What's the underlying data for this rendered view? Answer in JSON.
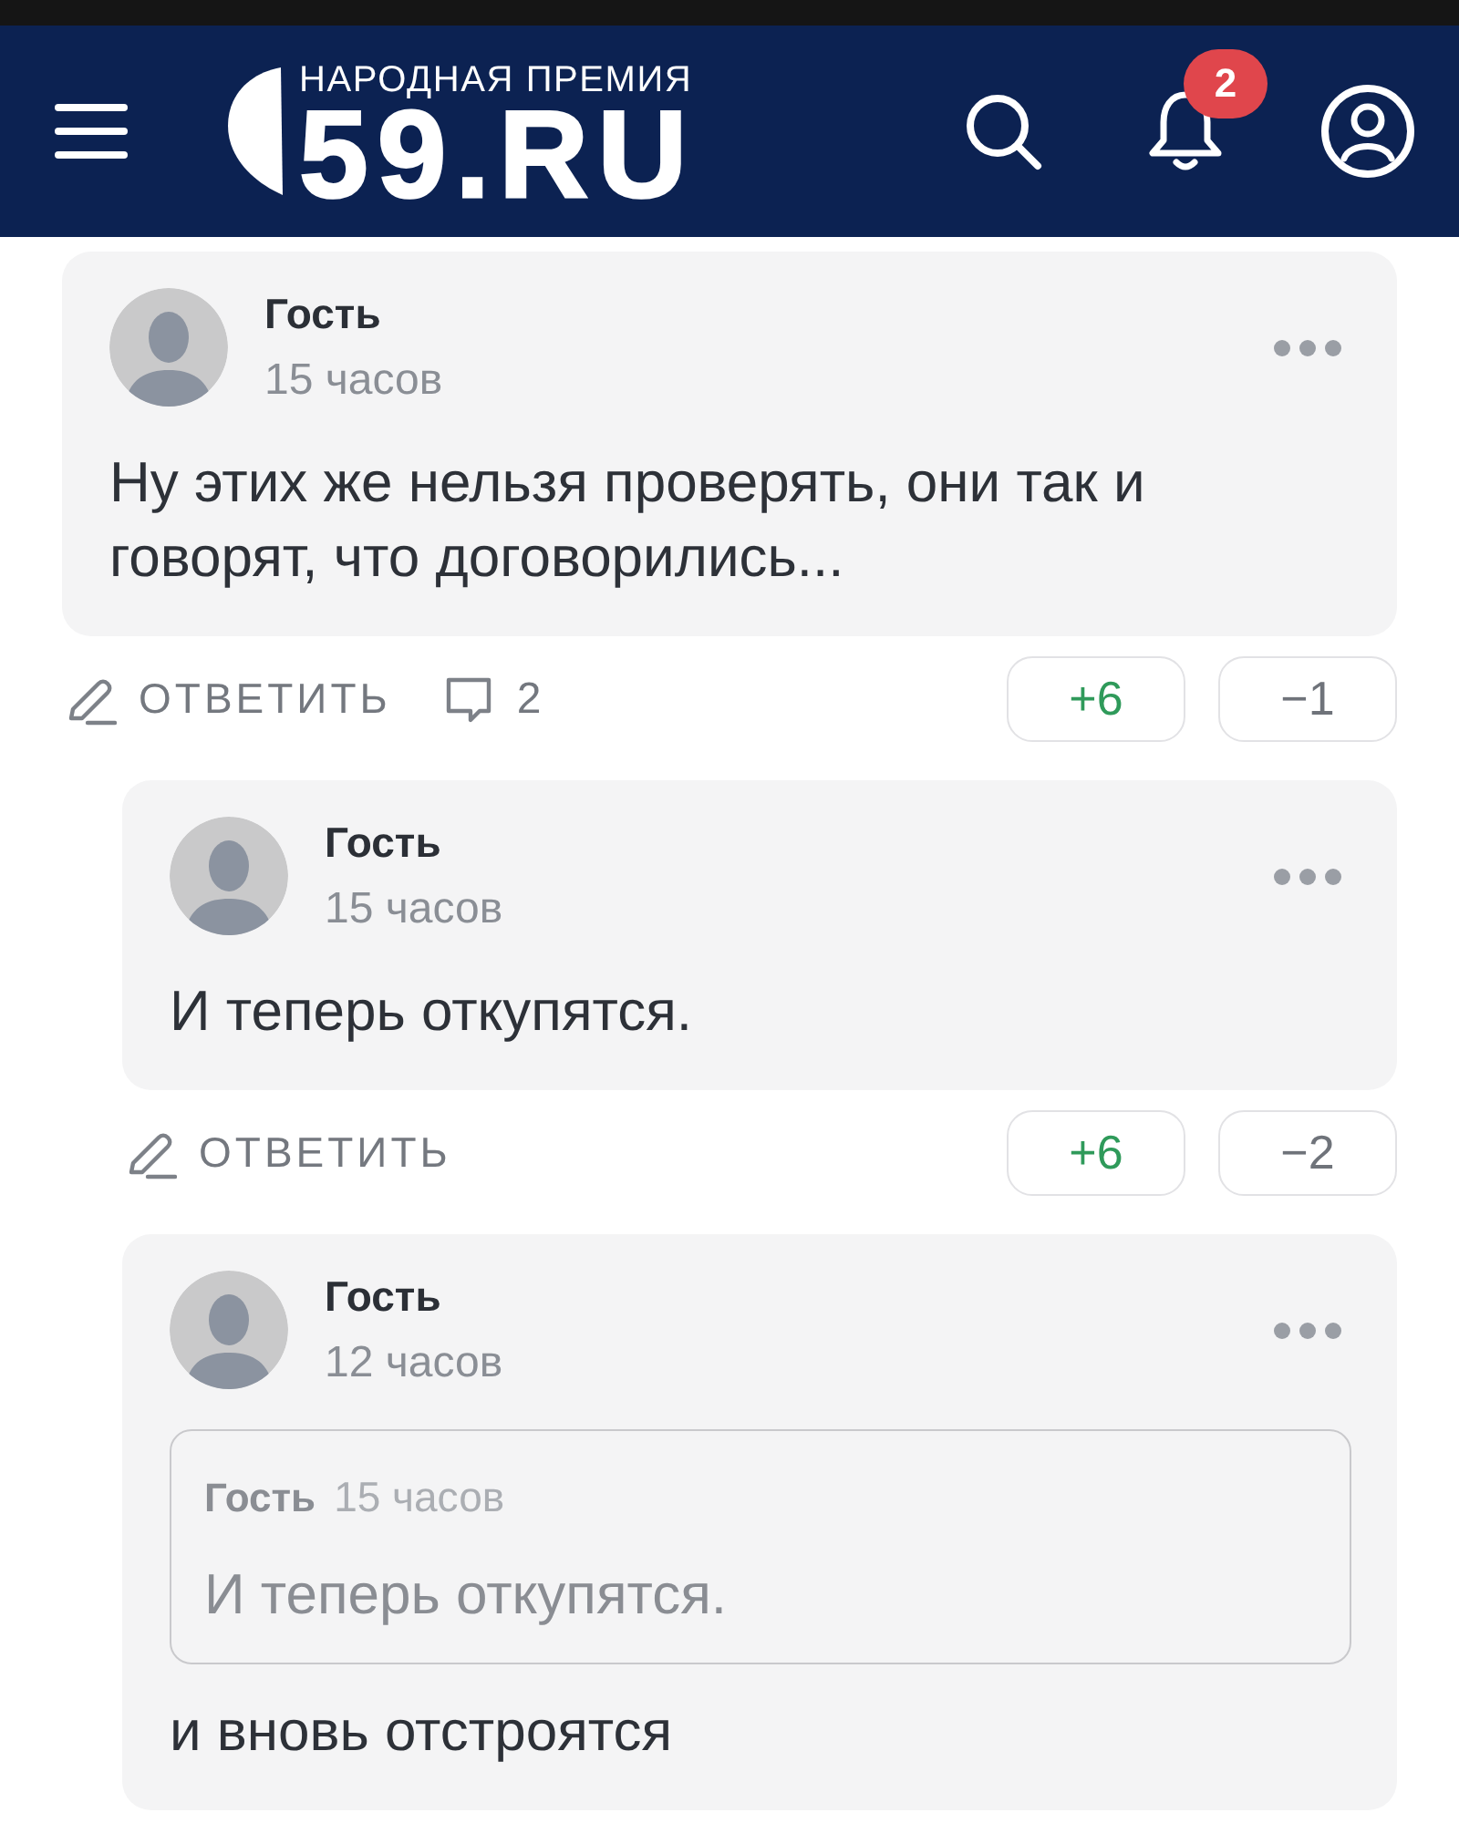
{
  "header": {
    "logo": {
      "caption": "НАРОДНАЯ ПРЕМИЯ",
      "wordmark": "59.RU"
    },
    "notification_badge": "2"
  },
  "comments": [
    {
      "author": "Гость",
      "time": "15 часов",
      "text": "Ну этих же нельзя проверять, они так и говорят, что договорились...",
      "actions": {
        "reply": "ОТВЕТИТЬ",
        "reply_count": "2",
        "votes": [
          {
            "kind": "up",
            "label": "+6"
          },
          {
            "kind": "down",
            "label": "−1"
          }
        ]
      },
      "children": [
        {
          "author": "Гость",
          "time": "15 часов",
          "text": "И теперь откупятся.",
          "actions": {
            "reply": "ОТВЕТИТЬ",
            "votes": [
              {
                "kind": "up",
                "label": "+6"
              },
              {
                "kind": "down",
                "label": "−2"
              }
            ]
          }
        },
        {
          "author": "Гость",
          "time": "12 часов",
          "quote": {
            "author": "Гость",
            "time": "15 часов",
            "text": "И теперь откупятся."
          },
          "text": "и вновь отстроятся"
        }
      ]
    }
  ]
}
